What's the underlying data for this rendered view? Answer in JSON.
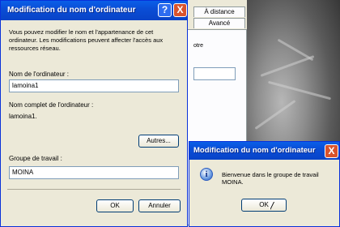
{
  "main_dialog": {
    "title": "Modification du nom d'ordinateur",
    "help_label": "?",
    "close_label": "X",
    "description": "Vous pouvez modifier le nom et l'appartenance de cet ordinateur. Les modifications peuvent affecter l'accès aux ressources réseau.",
    "computer_name_label": "Nom de l'ordinateur :",
    "computer_name_value": "lamoina1",
    "full_name_label": "Nom complet de l'ordinateur :",
    "full_name_value": "lamoina1.",
    "more_button": "Autres...",
    "workgroup_label": "Groupe de travail :",
    "workgroup_value": "MOINA",
    "ok_button": "OK",
    "cancel_button": "Annuler"
  },
  "background_window": {
    "tab_1": "À distance",
    "tab_2": "Avancé",
    "partial_text": "otre"
  },
  "message_box": {
    "title": "Modification du nom d'ordinateur",
    "close_label": "X",
    "icon": "info-icon",
    "message": "Bienvenue dans le groupe de travail MOINA.",
    "ok_button": "OK"
  }
}
